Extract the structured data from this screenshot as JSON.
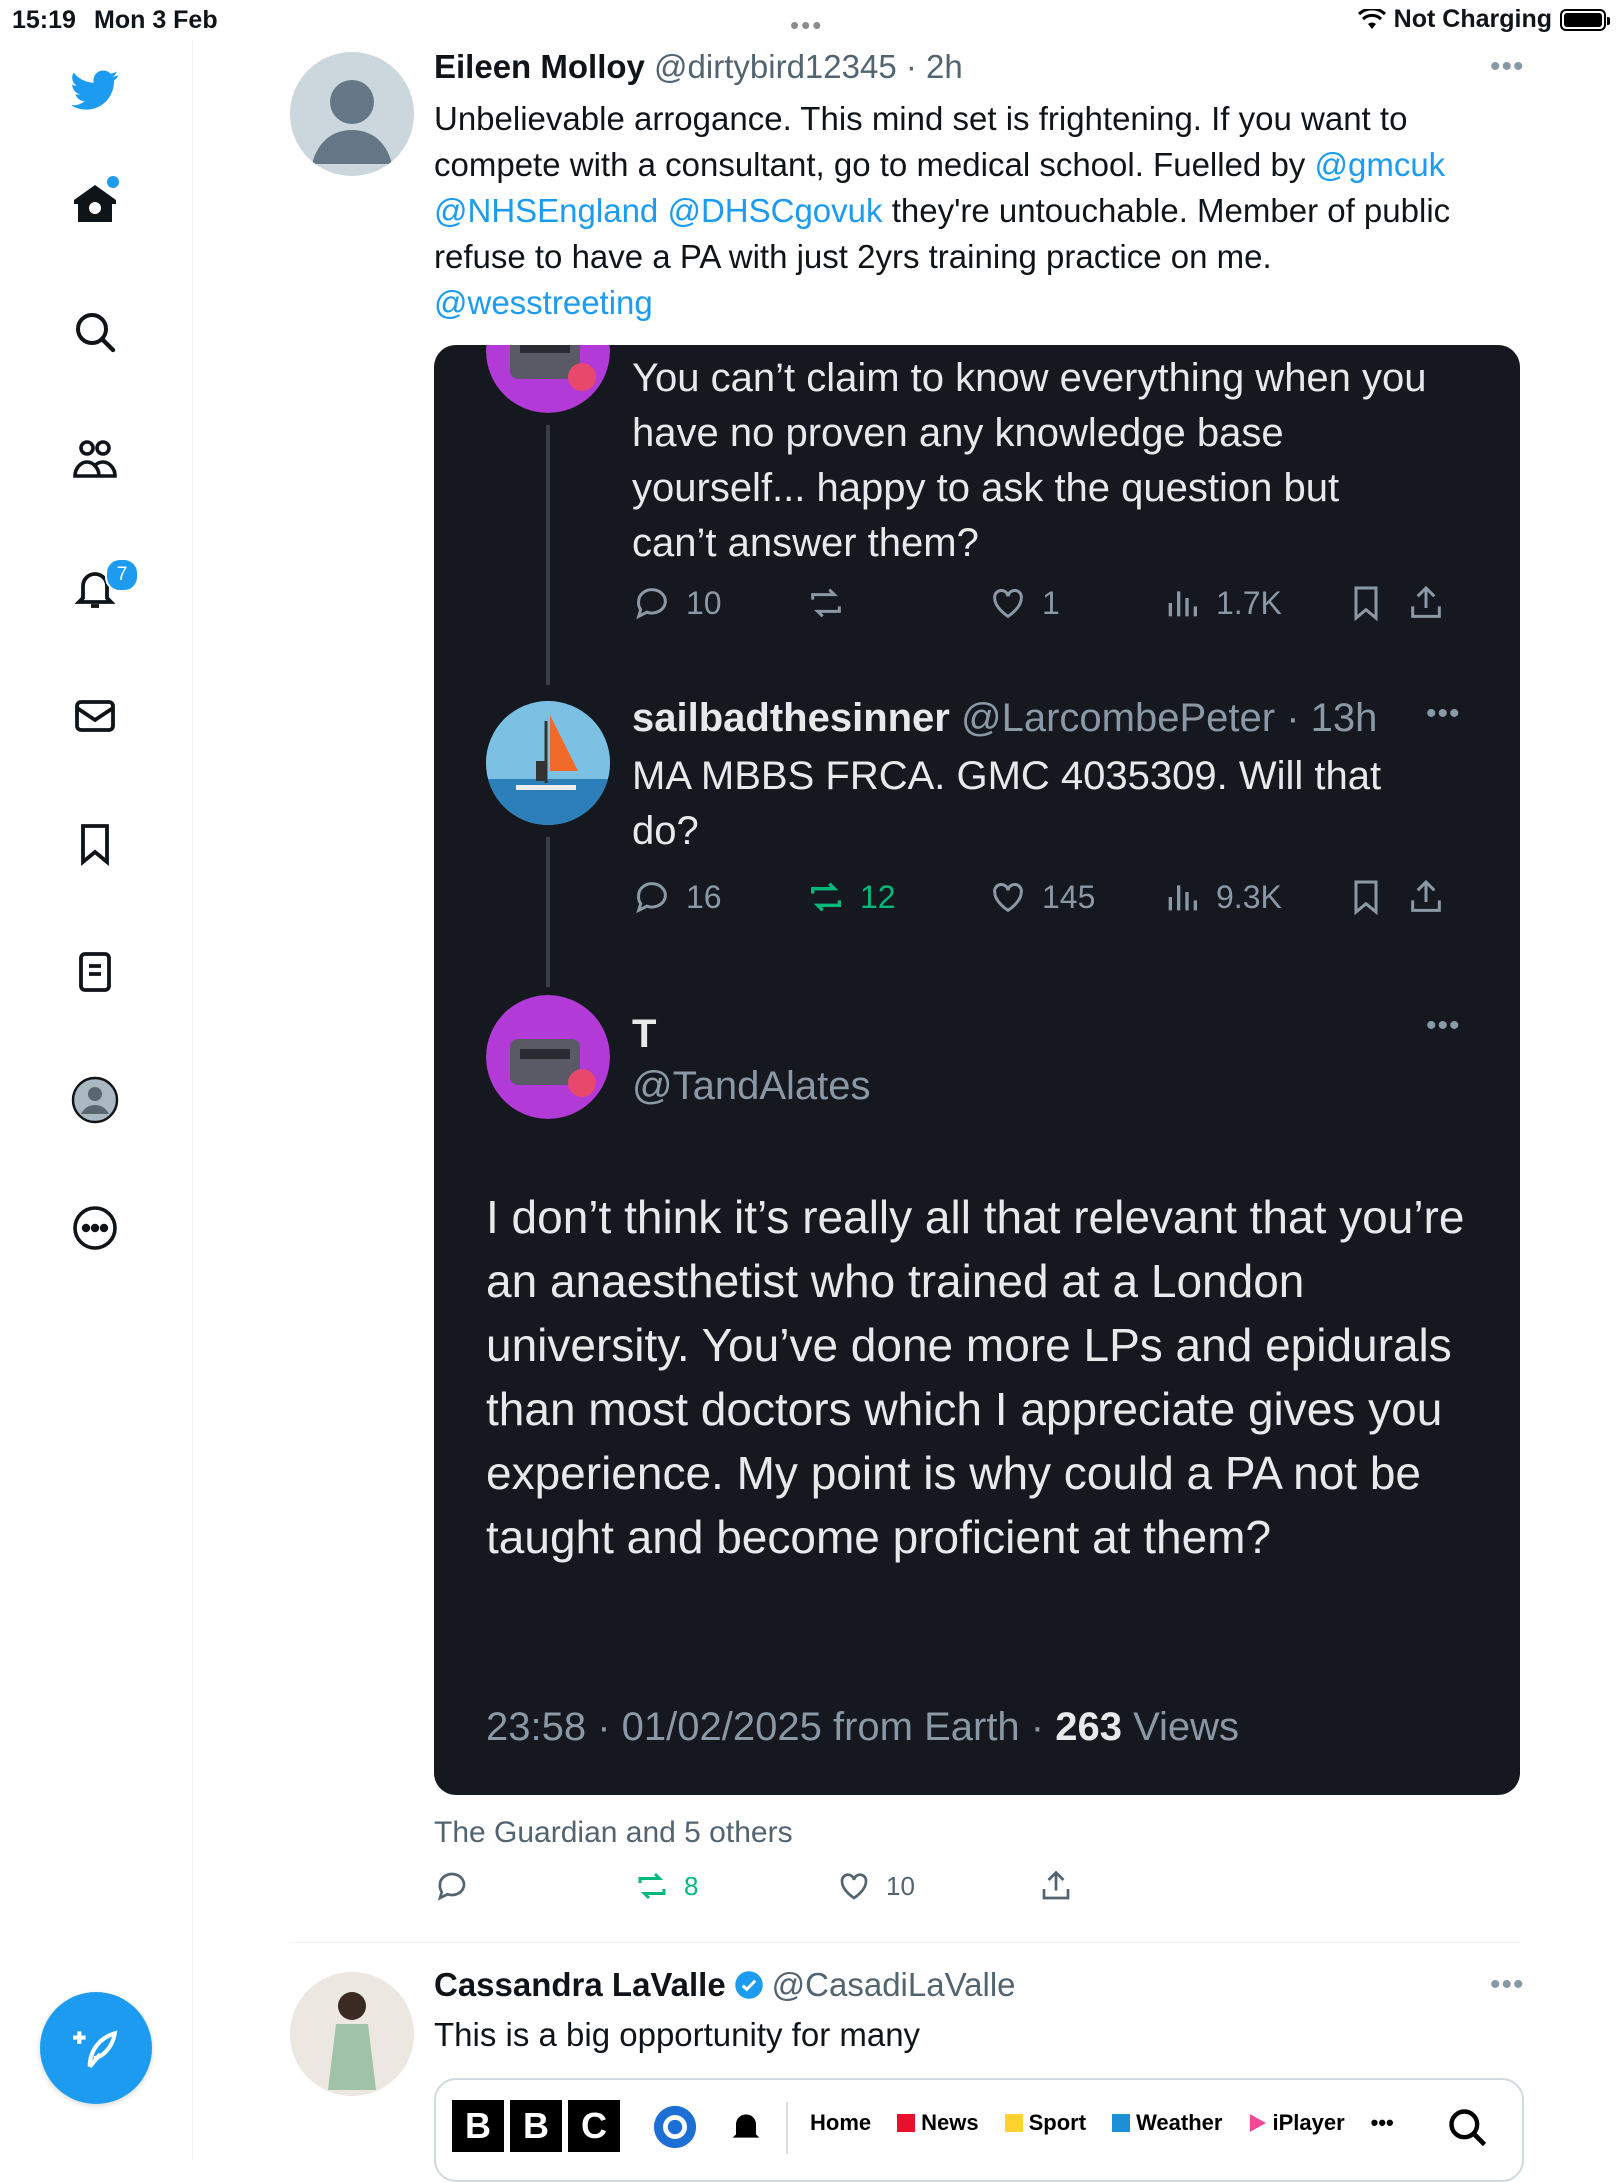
{
  "status_bar": {
    "time": "15:19",
    "date": "Mon 3 Feb",
    "center_dots": "•••",
    "network": "Not Charging"
  },
  "sidebar": {
    "notifications_badge": "7",
    "icons": [
      "twitter-bird-icon",
      "home-icon",
      "search-icon",
      "communities-icon",
      "bell-icon",
      "mail-icon",
      "bookmark-icon",
      "lists-icon",
      "profile-icon",
      "more-icon",
      "compose-icon"
    ]
  },
  "tweet1": {
    "name": "Eileen Molloy",
    "handle": "@dirtybird12345",
    "time": "· 2h",
    "text_1": "Unbelievable arrogance. This mind set is frightening. If you want to compete with a consultant, go to medical school. Fuelled by ",
    "mention_1": "@gmcuk",
    "mention_2": "@NHSEngland",
    "mention_3": "@DHSCgovuk",
    "text_2": " they're untouchable. Member of public refuse to have a PA with just 2yrs training practice on me.",
    "mention_4": "@wesstreeting",
    "social_context": "The Guardian and 5 others",
    "actions": {
      "replies": "",
      "retweets": "8",
      "likes": "10"
    }
  },
  "screenshot": {
    "reply1": {
      "text": "You can’t claim to know everything when you have no proven any knowledge base yourself... happy to ask the question but can’t answer them?",
      "replies": "10",
      "retweets": "",
      "likes": "1",
      "views": "1.7K"
    },
    "reply2": {
      "name": "sailbadthesinner",
      "handle": "@LarcombePeter",
      "time": "· 13h",
      "text": "MA MBBS FRCA. GMC 4035309. Will that do?",
      "replies": "16",
      "retweets": "12",
      "likes": "145",
      "views": "9.3K"
    },
    "main": {
      "name": "T",
      "handle": "@TandAlates",
      "text": "I don’t think it’s really all that relevant that you’re an anaesthetist who trained at a London university. You’ve done more LPs and epidurals than most doctors which I appreciate gives you experience. My point is why could a PA not be taught and become proficient at them?",
      "timestamp": "23:58 · 01/02/2025 from Earth · ",
      "views_count": "263",
      "views_label": " Views"
    }
  },
  "tweet2": {
    "name": "Cassandra LaVallе",
    "handle": "@CasadiLaValle",
    "text": "This is a big opportunity for many",
    "bbc": {
      "logo": [
        "B",
        "B",
        "C"
      ],
      "nav": [
        "Home",
        "News",
        "Sport",
        "Weather",
        "iPlayer"
      ],
      "colors": {
        "news": "#e8102d",
        "sport": "#ffd230",
        "weather": "#1c8fd6",
        "iplayer": "#f54997"
      }
    }
  },
  "colors": {
    "accent": "#1d9bf0",
    "retweet": "#00ba7c",
    "dark_bg": "#15181e"
  }
}
